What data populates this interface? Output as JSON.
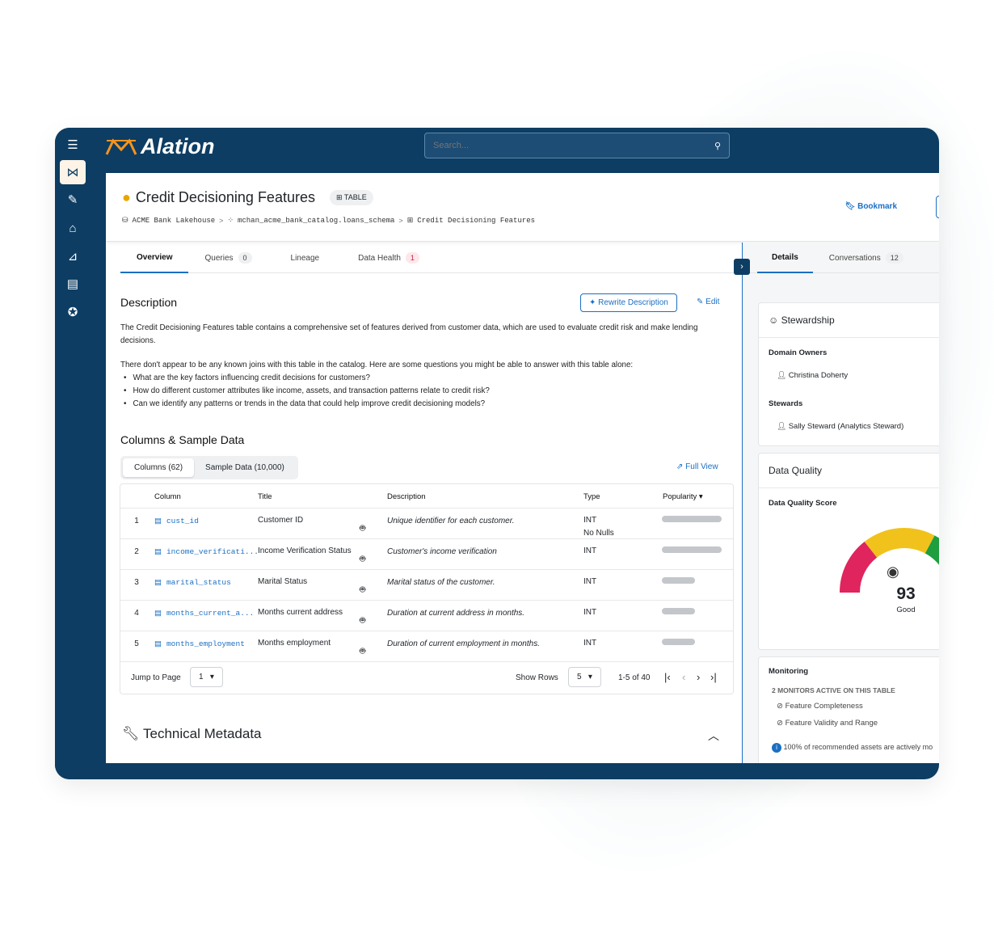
{
  "header": {
    "brand": "Alation",
    "search_placeholder": "Search..."
  },
  "sidebar": {
    "items": [
      "menu",
      "catalog",
      "compose",
      "institution",
      "analytics",
      "store",
      "governance"
    ]
  },
  "asset": {
    "title": "Credit Decisioning Features",
    "type_badge": "TABLE",
    "bookmark": "Bookmark",
    "breadcrumb": [
      "ACME Bank Lakehouse",
      "mchan_acme_bank_catalog.loans_schema",
      "Credit Decisioning Features"
    ]
  },
  "tabs": [
    {
      "label": "Overview"
    },
    {
      "label": "Queries",
      "count": "0"
    },
    {
      "label": "Lineage"
    },
    {
      "label": "Data Health",
      "count": "1"
    }
  ],
  "description": {
    "heading": "Description",
    "rewrite": "Rewrite Description",
    "edit": "Edit",
    "p1": "The Credit Decisioning Features table contains a comprehensive set of features derived from customer data, which are used to evaluate credit risk and make lending decisions.",
    "p2": "There don't appear to be any known joins with this table in the catalog. Here are some questions you might be able to answer with this table alone:",
    "bullets": [
      "What are the key factors influencing credit decisions for customers?",
      "How do different customer attributes like income, assets, and transaction patterns relate to credit risk?",
      "Can we identify any patterns or trends in the data that could help improve credit decisioning models?"
    ]
  },
  "columns_section": {
    "heading": "Columns & Sample Data",
    "seg": [
      "Columns (62)",
      "Sample Data (10,000)"
    ],
    "full_view": "Full View",
    "headers": [
      "Column",
      "Title",
      "Description",
      "Type",
      "Popularity"
    ],
    "rows": [
      {
        "n": "1",
        "col": "cust_id",
        "title": "Customer ID",
        "desc": "Unique identifier for each customer.",
        "type": "INT",
        "type2": "No Nulls",
        "pop": 0.9
      },
      {
        "n": "2",
        "col": "income_verificati...",
        "title": "Income Verification Status",
        "desc": "Customer's income verification",
        "type": "INT",
        "type2": "",
        "pop": 0.9
      },
      {
        "n": "3",
        "col": "marital_status",
        "title": "Marital Status",
        "desc": "Marital status of the customer.",
        "type": "INT",
        "type2": "",
        "pop": 0.5
      },
      {
        "n": "4",
        "col": "months_current_a...",
        "title": "Months current address",
        "desc": "Duration at current address in months.",
        "type": "INT",
        "type2": "",
        "pop": 0.5
      },
      {
        "n": "5",
        "col": "months_employment",
        "title": "Months employment",
        "desc": "Duration of current employment in months.",
        "type": "INT",
        "type2": "",
        "pop": 0.5
      }
    ],
    "pager": {
      "jump_label": "Jump to Page",
      "page": "1",
      "show_rows_label": "Show Rows",
      "rows": "5",
      "range": "1-5 of 40"
    }
  },
  "tech": {
    "heading": "Technical Metadata"
  },
  "right": {
    "tabs": [
      {
        "label": "Details"
      },
      {
        "label": "Conversations",
        "count": "12"
      }
    ],
    "stewardship": {
      "heading": "Stewardship",
      "owners_label": "Domain Owners",
      "owner": "Christina Doherty",
      "stewards_label": "Stewards",
      "steward": "Sally Steward (Analytics Steward)"
    },
    "quality": {
      "heading": "Data Quality",
      "score_label": "Data Quality Score",
      "score": "93",
      "rating": "Good",
      "colors": [
        "#e0245e",
        "#f1c21b",
        "#1e9e3e"
      ]
    },
    "monitoring": {
      "heading": "Monitoring",
      "active": "2 MONITORS ACTIVE ON THIS TABLE",
      "monitors": [
        "Feature Completeness",
        "Feature Validity and Range"
      ],
      "note": "100% of recommended assets are actively mo"
    }
  }
}
